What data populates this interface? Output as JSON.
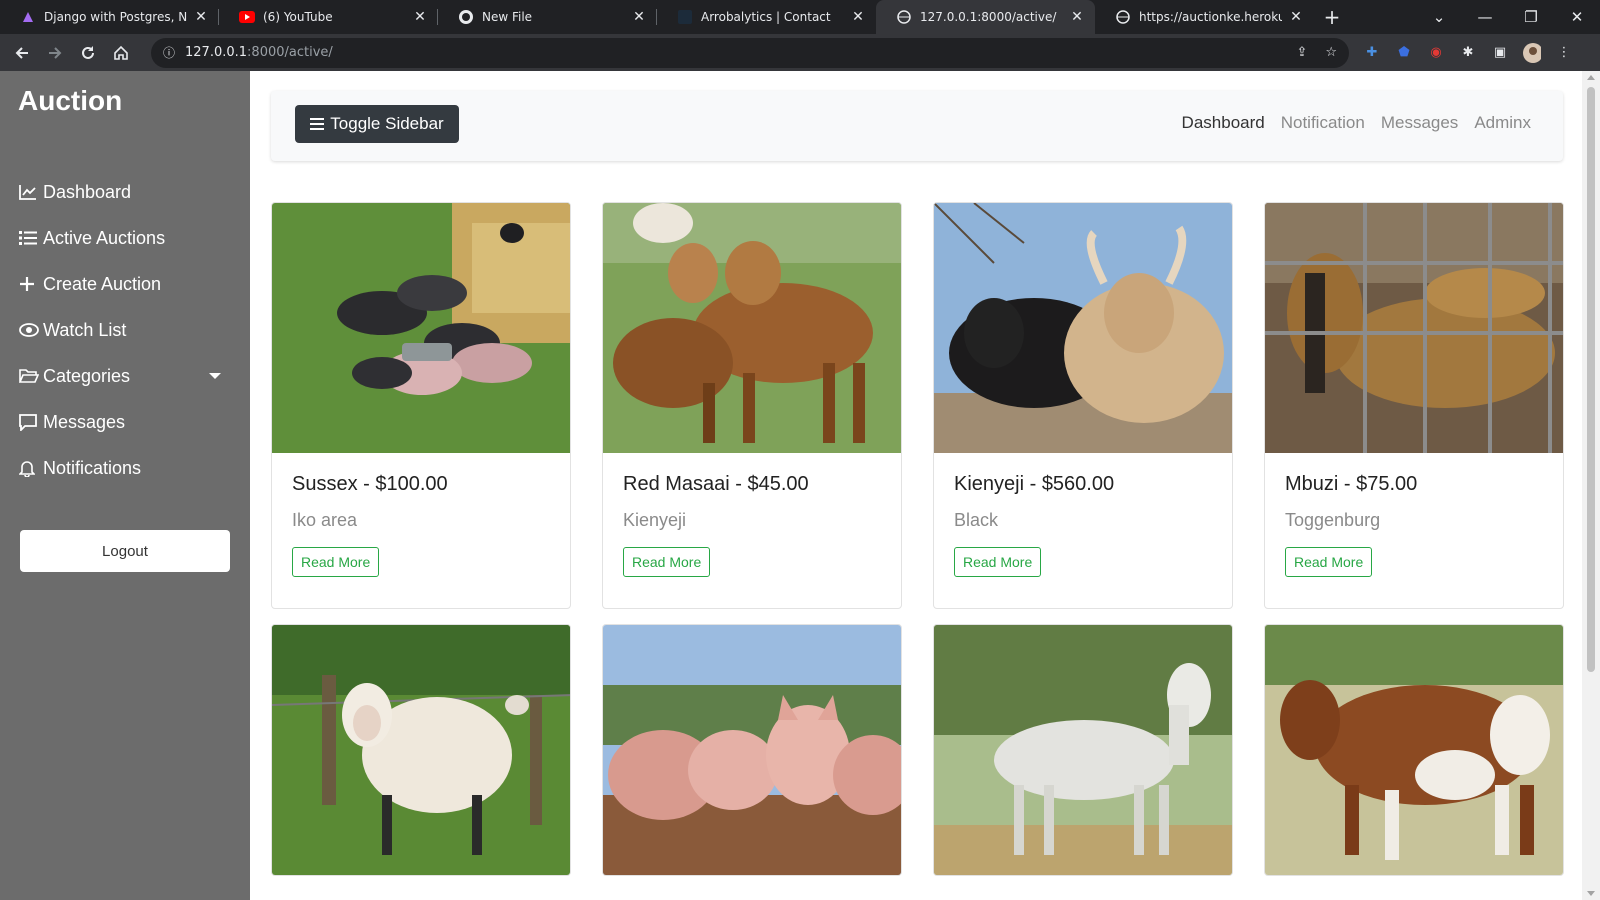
{
  "browser": {
    "tabs": [
      {
        "title": "Django with Postgres, Nginx,",
        "icon": "django-favicon"
      },
      {
        "title": "(6) YouTube",
        "icon": "youtube-favicon"
      },
      {
        "title": "New File",
        "icon": "github-favicon"
      },
      {
        "title": "Arrobalytics | Contact",
        "icon": "site-favicon"
      },
      {
        "title": "127.0.0.1:8000/active/",
        "icon": "globe-favicon"
      },
      {
        "title": "https://auctionke.herokuapp.",
        "icon": "globe-favicon"
      }
    ],
    "url_host": "127.0.0.1",
    "url_rest": ":8000/active/"
  },
  "sidebar": {
    "brand": "Auction",
    "items": [
      {
        "label": "Dashboard",
        "icon": "chart-area-icon"
      },
      {
        "label": "Active Auctions",
        "icon": "list-icon"
      },
      {
        "label": "Create Auction",
        "icon": "plus-icon"
      },
      {
        "label": "Watch List",
        "icon": "eye-icon"
      },
      {
        "label": "Categories",
        "icon": "folder-open-icon"
      },
      {
        "label": "Messages",
        "icon": "comment-icon"
      },
      {
        "label": "Notifications",
        "icon": "bell-icon"
      }
    ],
    "logout": "Logout"
  },
  "topbar": {
    "toggle": "Toggle Sidebar",
    "nav": [
      "Dashboard",
      "Notification",
      "Messages",
      "Adminx"
    ]
  },
  "cards": [
    {
      "title": "Sussex - $100.00",
      "breed": "Iko area",
      "button": "Read More",
      "image": "pigs-photo"
    },
    {
      "title": "Red Masaai - $45.00",
      "breed": "Kienyeji",
      "button": "Read More",
      "image": "sheep-photo"
    },
    {
      "title": "Kienyeji - $560.00",
      "breed": "Black",
      "button": "Read More",
      "image": "cattle-photo"
    },
    {
      "title": "Mbuzi - $75.00",
      "breed": "Toggenburg",
      "button": "Read More",
      "image": "goat-photo"
    },
    {
      "title": "",
      "breed": "",
      "button": "",
      "image": "white-sheep-photo"
    },
    {
      "title": "",
      "breed": "",
      "button": "",
      "image": "pink-pigs-photo"
    },
    {
      "title": "",
      "breed": "",
      "button": "",
      "image": "white-goat-photo"
    },
    {
      "title": "",
      "breed": "",
      "button": "",
      "image": "brown-cow-photo"
    }
  ]
}
